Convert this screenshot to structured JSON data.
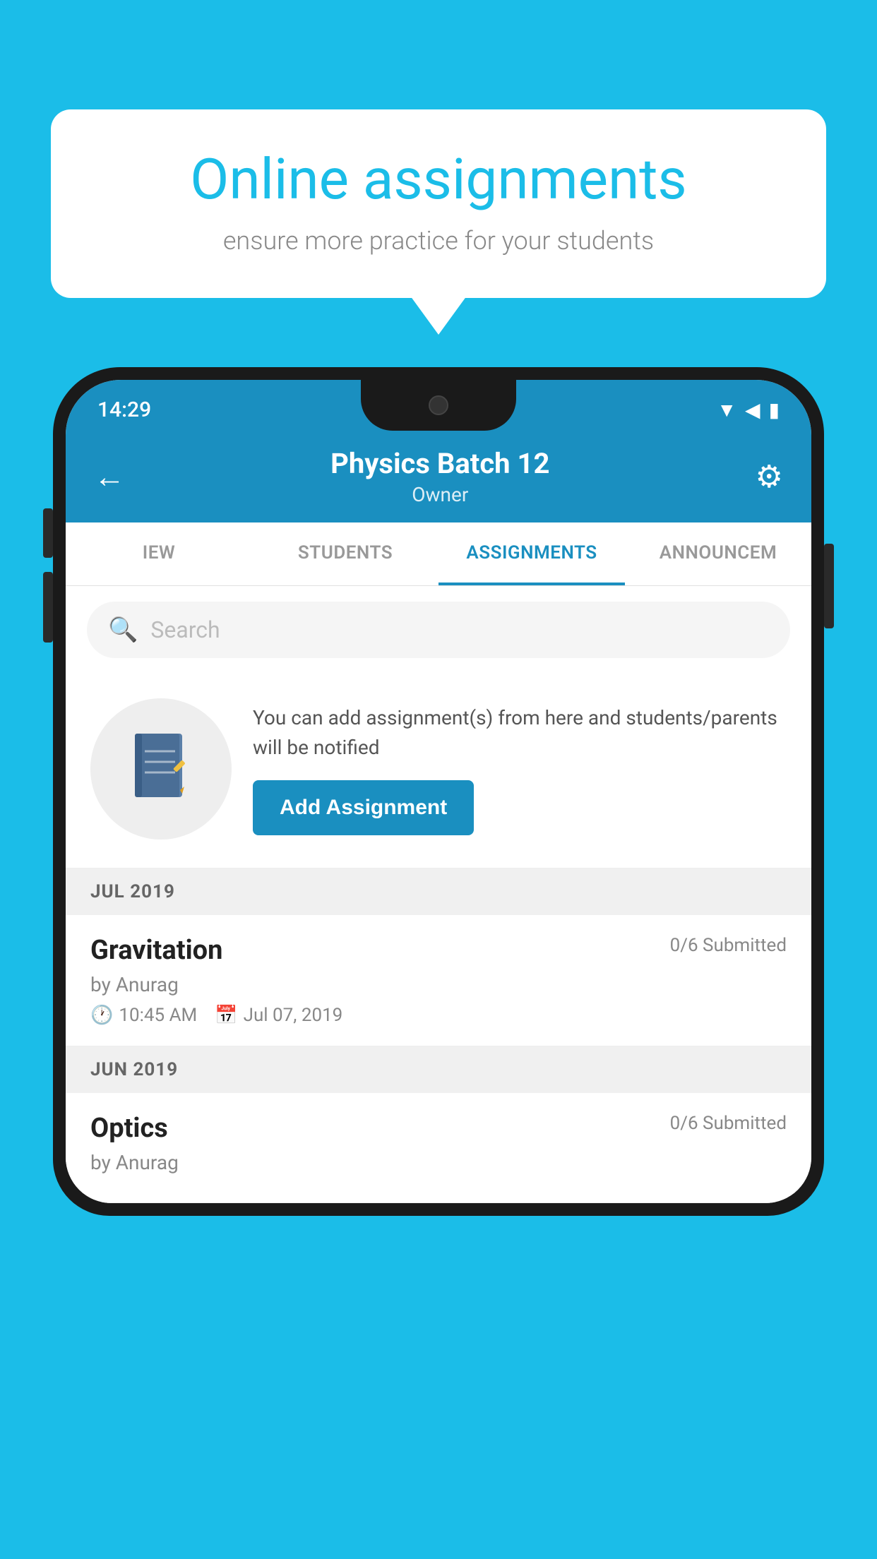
{
  "background_color": "#1BBDE8",
  "speech_bubble": {
    "title": "Online assignments",
    "subtitle": "ensure more practice for your students"
  },
  "phone": {
    "status_bar": {
      "time": "14:29",
      "icons": [
        "wifi",
        "signal",
        "battery"
      ]
    },
    "header": {
      "title": "Physics Batch 12",
      "subtitle": "Owner",
      "back_label": "←",
      "settings_label": "⚙"
    },
    "tabs": [
      {
        "label": "IEW",
        "active": false
      },
      {
        "label": "STUDENTS",
        "active": false
      },
      {
        "label": "ASSIGNMENTS",
        "active": true
      },
      {
        "label": "ANNOUNCEM",
        "active": false
      }
    ],
    "search": {
      "placeholder": "Search"
    },
    "promo": {
      "text": "You can add assignment(s) from here and students/parents will be notified",
      "button_label": "Add Assignment"
    },
    "sections": [
      {
        "month_label": "JUL 2019",
        "assignments": [
          {
            "title": "Gravitation",
            "submitted": "0/6 Submitted",
            "author": "by Anurag",
            "time": "10:45 AM",
            "date": "Jul 07, 2019"
          }
        ]
      },
      {
        "month_label": "JUN 2019",
        "assignments": [
          {
            "title": "Optics",
            "submitted": "0/6 Submitted",
            "author": "by Anurag",
            "time": "",
            "date": ""
          }
        ]
      }
    ]
  }
}
